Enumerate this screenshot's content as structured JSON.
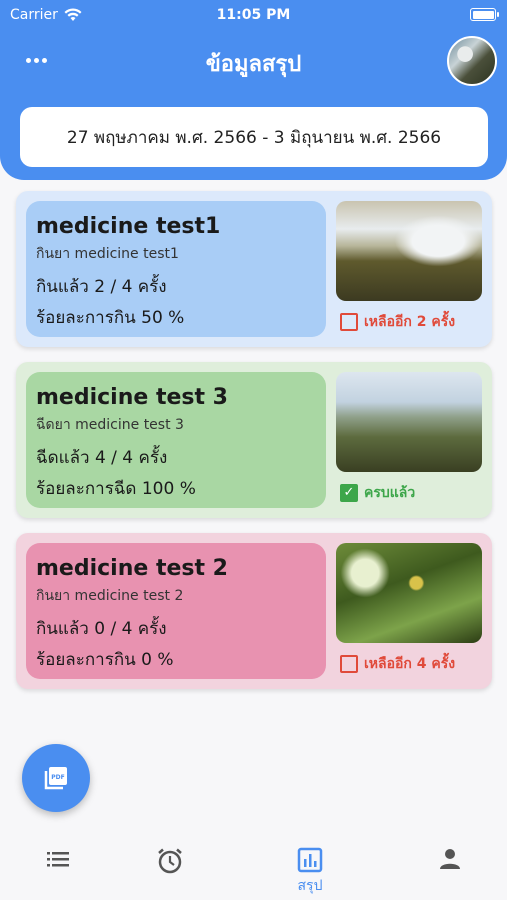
{
  "status_bar": {
    "carrier": "Carrier",
    "time": "11:05 PM"
  },
  "header": {
    "title": "ข้อมูลสรุป",
    "date_range": "27 พฤษภาคม พ.ศ. 2566 - 3 มิถุนายน พ.ศ. 2566"
  },
  "cards": [
    {
      "name": "medicine test1",
      "desc": "กินยา medicine test1",
      "count": "กินแล้ว 2 / 4 ครั้ง",
      "percent": "ร้อยละการกิน 50 %",
      "status": "เหลืออีก 2 ครั้ง",
      "done": false,
      "status_color": "#e04a3a"
    },
    {
      "name": "medicine test 3",
      "desc": "ฉีดยา medicine test 3",
      "count": "ฉีดแล้ว 4 / 4 ครั้ง",
      "percent": "ร้อยละการฉีด 100 %",
      "status": "ครบแล้ว",
      "done": true,
      "status_color": "#3da64a"
    },
    {
      "name": "medicine test 2",
      "desc": "กินยา medicine test 2",
      "count": "กินแล้ว 0 / 4 ครั้ง",
      "percent": "ร้อยละการกิน 0 %",
      "status": "เหลืออีก 4 ครั้ง",
      "done": false,
      "status_color": "#e04a3a"
    }
  ],
  "fab": {
    "icon": "pdf-icon",
    "label": "PDF"
  },
  "tabs": [
    {
      "icon": "list-icon",
      "label": ""
    },
    {
      "icon": "alarm-clock-icon",
      "label": ""
    },
    {
      "icon": "bar-chart-icon",
      "label": "สรุป",
      "active": true
    },
    {
      "icon": "person-icon",
      "label": ""
    }
  ],
  "colors": {
    "primary": "#4a8ef0",
    "card_blue": "#a9cdf6",
    "card_green": "#a9d7a3",
    "card_pink": "#e892b0",
    "alert": "#e04a3a",
    "ok": "#3da64a"
  }
}
